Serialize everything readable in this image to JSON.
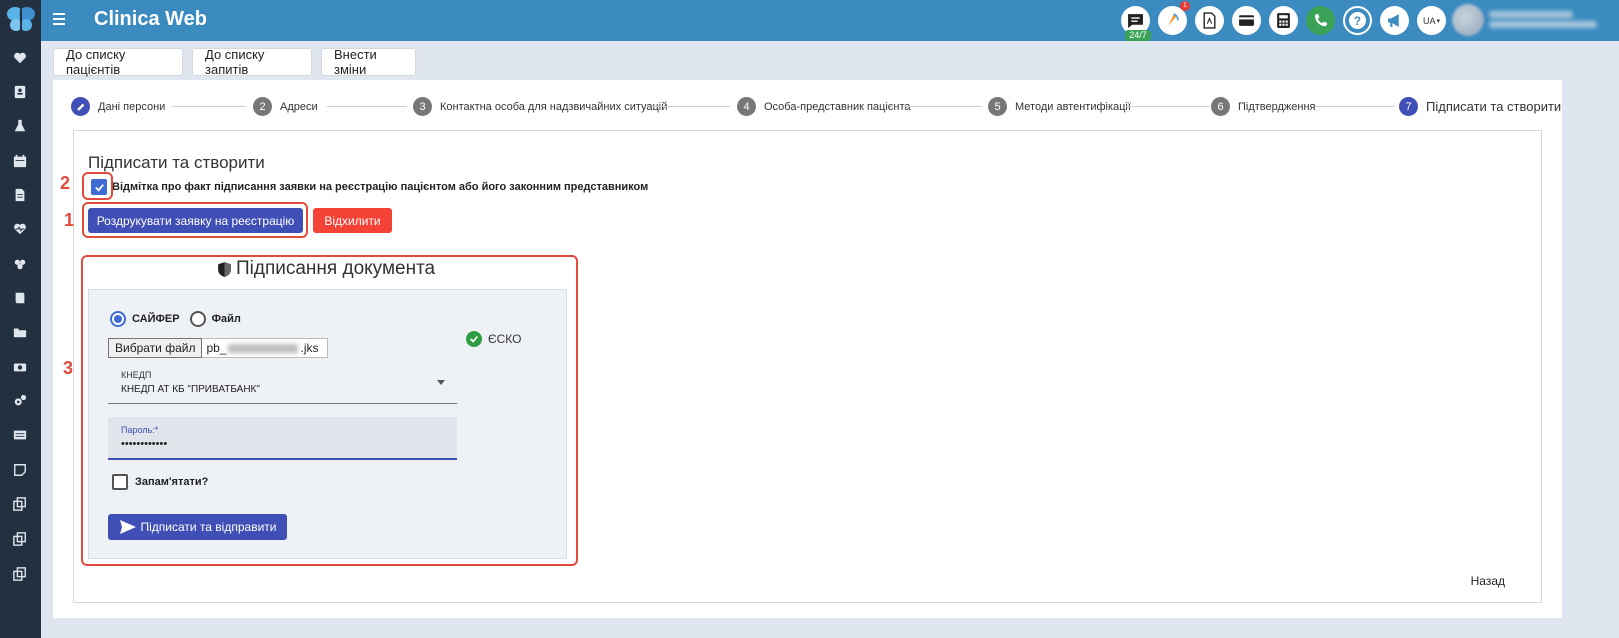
{
  "app": {
    "title": "Clinica Web",
    "badge_247": "24/7",
    "notif_count": "1",
    "lang": "UA"
  },
  "sidebar": {
    "items": [
      "heart-icon",
      "contact-card-icon",
      "flask-icon",
      "calendar-icon",
      "document-icon",
      "heartbeat-icon",
      "group-icon",
      "book-icon",
      "folder-icon",
      "money-icon",
      "gears-icon",
      "list-icon",
      "note-icon",
      "copy-icon-1",
      "copy-icon-2",
      "copy-icon-3"
    ]
  },
  "topbar": {
    "icons": [
      "chat-icon",
      "rocket-icon",
      "pdf-icon",
      "card-icon",
      "calculator-icon",
      "phone-icon",
      "help-icon",
      "megaphone-icon"
    ]
  },
  "actions": {
    "to_patients": "До списку пацієнтів",
    "to_requests": "До списку запитів",
    "edit": "Внести зміни"
  },
  "stepper": {
    "steps": [
      {
        "num": "1",
        "label": "Дані персони"
      },
      {
        "num": "2",
        "label": "Адреси"
      },
      {
        "num": "3",
        "label": "Контактна особа для надзвичайних ситуацій"
      },
      {
        "num": "4",
        "label": "Особа-представник пацієнта"
      },
      {
        "num": "5",
        "label": "Методи автентифікації"
      },
      {
        "num": "6",
        "label": "Підтвердження"
      },
      {
        "num": "7",
        "label": "Підписати та створити"
      }
    ]
  },
  "form": {
    "title": "Підписати та створити",
    "checkbox_label": "Відмітка про факт підписання заявки на реєстрацію пацієнтом або його законним представником",
    "print_button": "Роздрукувати заявку на реєстрацію",
    "reject_button": "Відхилити",
    "back": "Назад"
  },
  "sign": {
    "title": "Підписання документа",
    "radio_cipher": "САЙФЕР",
    "radio_file": "Файл",
    "choose_file": "Вибрати файл",
    "file_prefix": "pb_",
    "file_suffix": ".jks",
    "kndp_label": "КНЕДП",
    "kndp_value": "КНЕДП АТ КБ \"ПРИВАТБАНК\"",
    "password_label": "Пароль:*",
    "password_value": "••••••••••••",
    "remember": "Запам'ятати?",
    "submit": "Підписати та відправити",
    "esko": "ЄСКО"
  },
  "annotations": {
    "a1": "1",
    "a2": "2",
    "a3": "3"
  },
  "colors": {
    "primary": "#3f4fb5",
    "danger": "#f44336",
    "topbar": "#3b8bc0",
    "sidebar": "#233040",
    "annotation": "#e04b3c"
  }
}
